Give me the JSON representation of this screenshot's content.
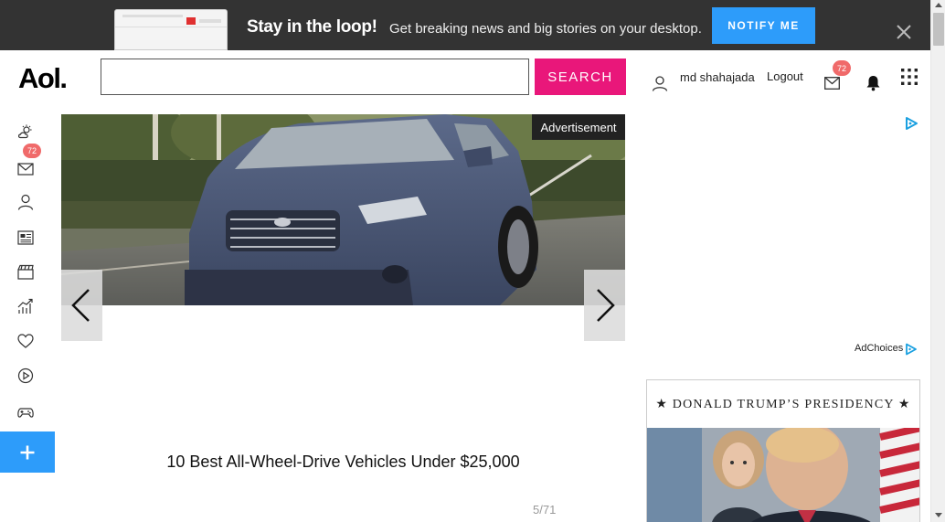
{
  "banner": {
    "title": "Stay in the loop!",
    "subtitle": "Get breaking news and big stories on your desktop.",
    "notify_label": "NOTIFY ME"
  },
  "header": {
    "logo": "Aol.",
    "search_value": "",
    "search_label": "SEARCH",
    "username": "md shahajada",
    "logout_label": "Logout",
    "mail_count": "72"
  },
  "sidebar": {
    "mail_count": "72",
    "items": [
      {
        "icon": "weather-icon"
      },
      {
        "icon": "mail-icon"
      },
      {
        "icon": "person-icon"
      },
      {
        "icon": "news-icon"
      },
      {
        "icon": "entertainment-icon"
      },
      {
        "icon": "finance-icon"
      },
      {
        "icon": "lifestyle-icon"
      },
      {
        "icon": "video-icon"
      },
      {
        "icon": "games-icon"
      }
    ]
  },
  "slideshow": {
    "ad_label": "Advertisement",
    "caption": "10 Best All-Wheel-Drive Vehicles Under $25,000",
    "counter": "5/71"
  },
  "right_rail": {
    "adchoices_label": "AdChoices",
    "feature_title": "★ DONALD TRUMP’S PRESIDENCY ★"
  },
  "colors": {
    "accent_pink": "#e9177a",
    "accent_blue": "#2d9cfa",
    "badge_red": "#f06a6a",
    "banner_bg": "#333333"
  }
}
